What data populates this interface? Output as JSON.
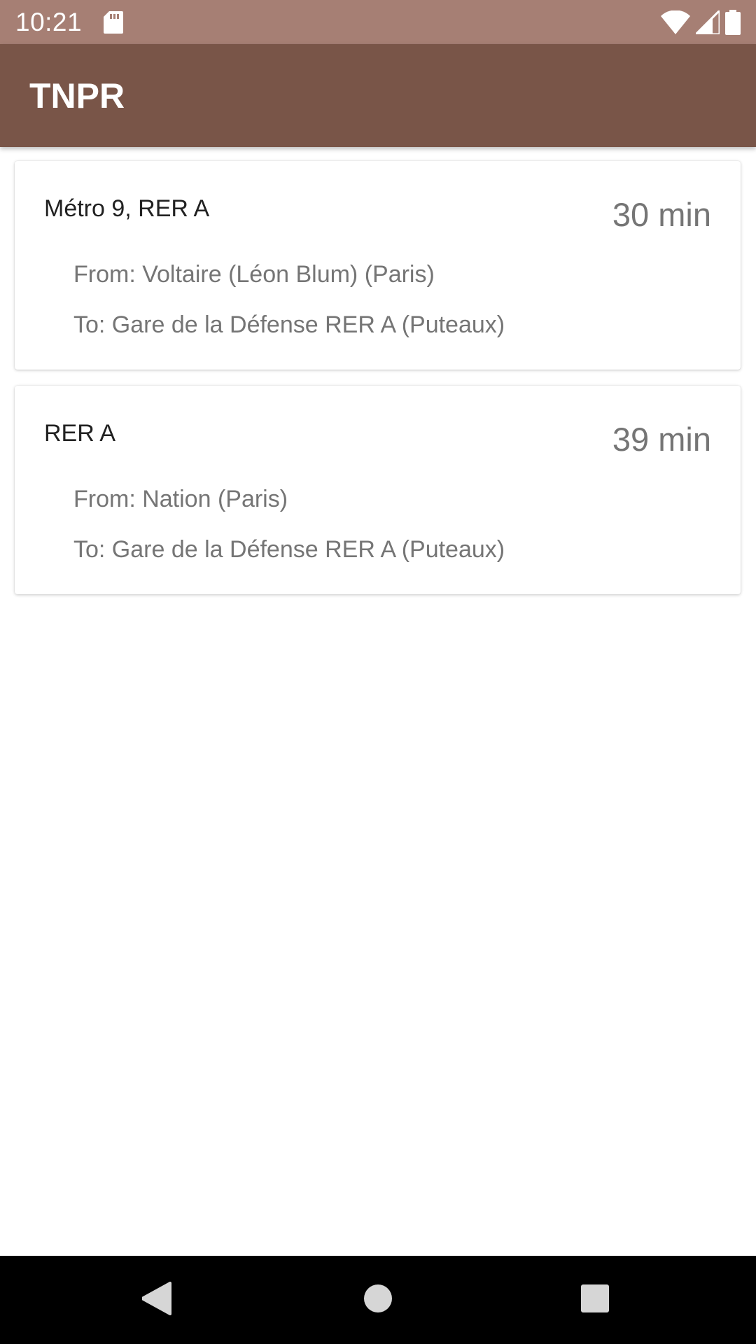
{
  "status_bar": {
    "time": "10:21",
    "icons": [
      "sd-card-icon",
      "wifi-icon",
      "signal-icon",
      "battery-icon"
    ]
  },
  "app_bar": {
    "title": "TNPR"
  },
  "routes": [
    {
      "lines": "Métro 9, RER A",
      "duration": "30 min",
      "from": "From: Voltaire (Léon Blum) (Paris)",
      "to": "To: Gare de la Défense RER A (Puteaux)"
    },
    {
      "lines": "RER A",
      "duration": "39 min",
      "from": "From: Nation (Paris)",
      "to": "To: Gare de la Défense RER A (Puteaux)"
    }
  ],
  "nav_bar": {
    "icons": [
      "back-icon",
      "home-icon",
      "recents-icon"
    ]
  },
  "colors": {
    "status_bar": "#a67f74",
    "app_bar": "#795548",
    "nav_bar": "#000000"
  }
}
